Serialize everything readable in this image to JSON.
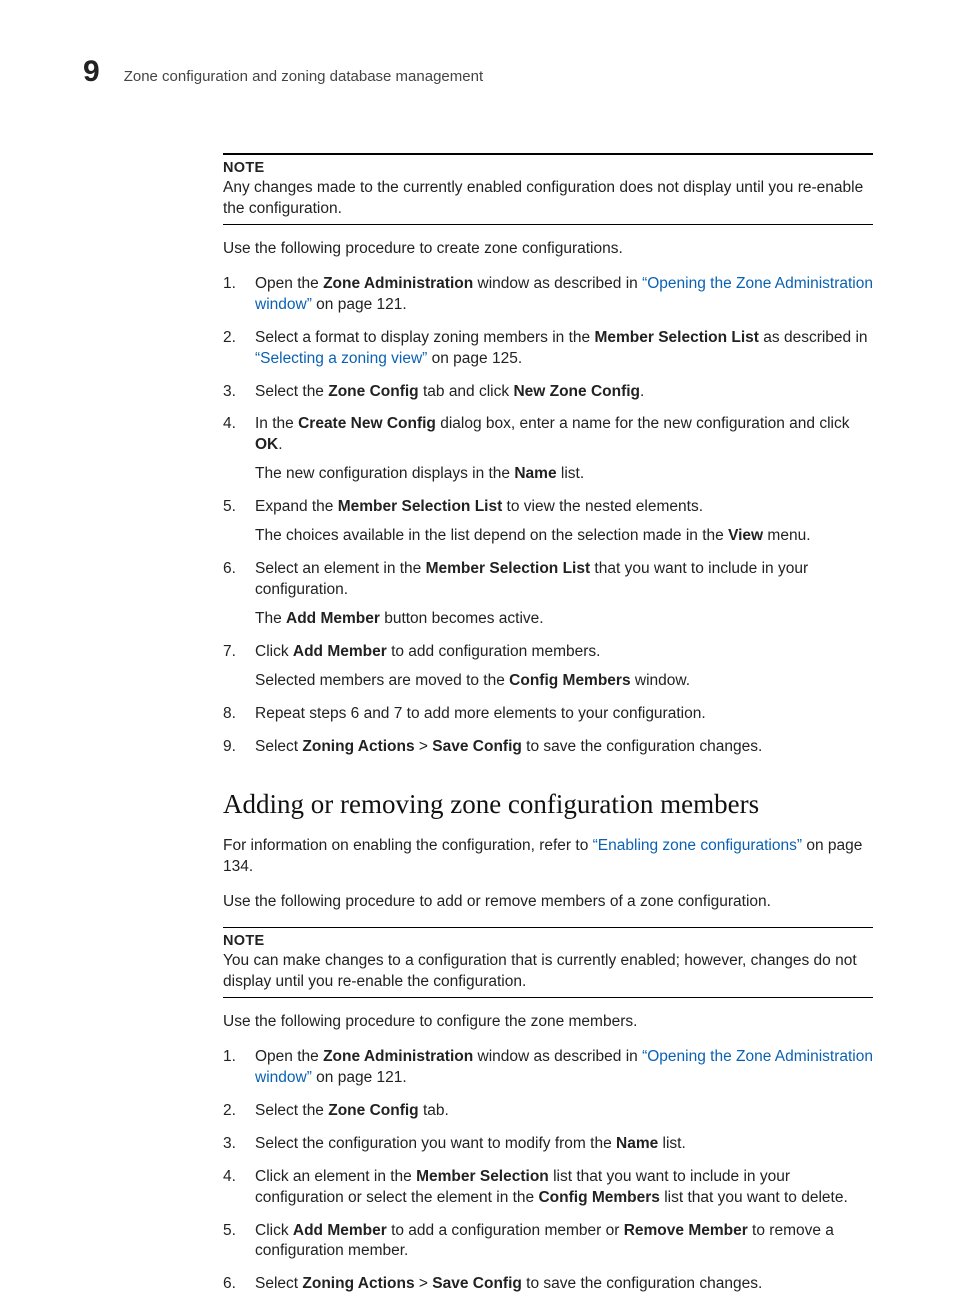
{
  "header": {
    "chapter_number": "9",
    "running_title": "Zone configuration and zoning database management"
  },
  "noteA": {
    "label": "NOTE",
    "body": "Any changes made to the currently enabled configuration does not display until you re-enable the configuration."
  },
  "introA": "Use the following procedure to create zone configurations.",
  "stepsA": {
    "s1a": "Open the ",
    "s1b": "Zone Administration",
    "s1c": " window as described in ",
    "s1link": "“Opening the Zone Administration window”",
    "s1d": " on page 121.",
    "s2a": "Select a format to display zoning members in the ",
    "s2b": "Member Selection List",
    "s2c": " as described in ",
    "s2link": "“Selecting a zoning view”",
    "s2d": " on page 125.",
    "s3a": "Select the ",
    "s3b": "Zone Config",
    "s3c": " tab and click ",
    "s3d": "New Zone Config",
    "s3e": ".",
    "s4a": "In the ",
    "s4b": "Create New Config",
    "s4c": " dialog box, enter a name for the new configuration and click ",
    "s4d": "OK",
    "s4e": ".",
    "s4sub_a": "The new configuration displays in the ",
    "s4sub_b": "Name",
    "s4sub_c": " list.",
    "s5a": "Expand the ",
    "s5b": "Member Selection List",
    "s5c": " to view the nested elements.",
    "s5sub_a": "The choices available in the list depend on the selection made in the ",
    "s5sub_b": "View",
    "s5sub_c": " menu.",
    "s6a": "Select an element in the ",
    "s6b": "Member Selection List",
    "s6c": " that you want to include in your configuration.",
    "s6sub_a": "The ",
    "s6sub_b": "Add Member",
    "s6sub_c": " button becomes active.",
    "s7a": "Click ",
    "s7b": "Add Member",
    "s7c": " to add configuration members.",
    "s7sub_a": "Selected members are moved to the ",
    "s7sub_b": "Config Members",
    "s7sub_c": " window.",
    "s8": "Repeat steps 6 and 7 to add more elements to your configuration.",
    "s9a": "Select ",
    "s9b": "Zoning Actions",
    "s9c": " > ",
    "s9d": "Save Config",
    "s9e": " to save the configuration changes."
  },
  "sectionB": {
    "title": "Adding or removing zone configuration members",
    "intro_a": "For information on enabling the configuration, refer to ",
    "intro_link": "“Enabling zone configurations”",
    "intro_b": " on page 134.",
    "intro2": "Use the following procedure to add or remove members of a zone configuration."
  },
  "noteB": {
    "label": "NOTE",
    "body": "You can make changes to a configuration that is currently enabled; however, changes do not display until you re-enable the configuration."
  },
  "introB2": "Use the following procedure to configure the zone members.",
  "stepsB": {
    "s1a": "Open the ",
    "s1b": "Zone Administration",
    "s1c": " window as described in ",
    "s1link": "“Opening the Zone Administration window”",
    "s1d": " on page 121.",
    "s2a": "Select the ",
    "s2b": "Zone Config",
    "s2c": " tab.",
    "s3a": "Select the configuration you want to modify from the ",
    "s3b": "Name",
    "s3c": " list.",
    "s4a": "Click an element in the ",
    "s4b": "Member Selection",
    "s4c": " list that you want to include in your configuration or select the element in the ",
    "s4d": "Config Members",
    "s4e": " list that you want to delete.",
    "s5a": "Click ",
    "s5b": "Add Member",
    "s5c": " to add a configuration member or ",
    "s5d": "Remove Member",
    "s5e": " to remove a configuration member.",
    "s6a": "Select ",
    "s6b": "Zoning Actions",
    "s6c": " > ",
    "s6d": "Save Config",
    "s6e": " to save the configuration changes."
  }
}
